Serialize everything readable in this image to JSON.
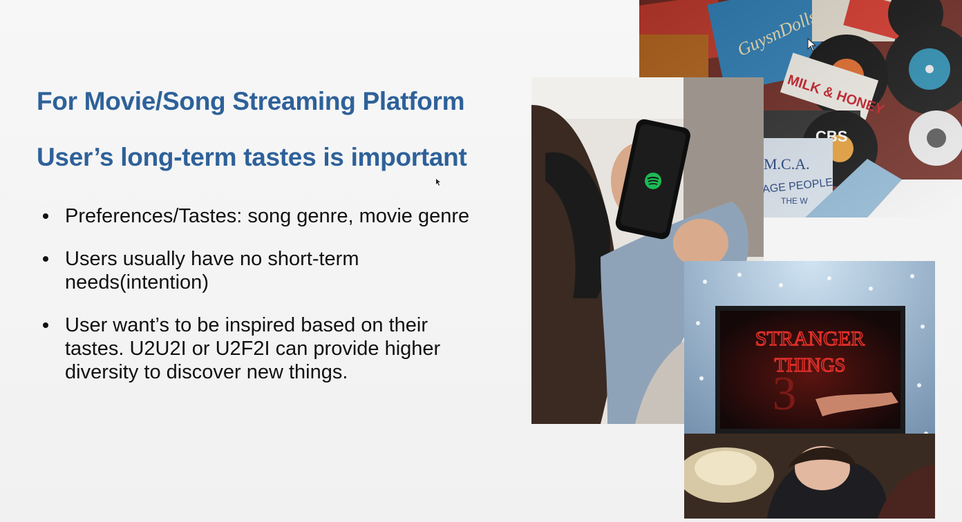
{
  "slide": {
    "title": "For Movie/Song Streaming Platform",
    "subtitle": "User’s long-term tastes is important",
    "bullets": [
      "Preferences/Tastes: song genre, movie genre",
      "Users usually have no short-term needs(intention)",
      "User want’s to be inspired based on their tastes. U2U2I or U2F2I can provide higher diversity to discover new things."
    ]
  },
  "images": {
    "records": {
      "labels": [
        "GuysnDolls",
        "MILK & HONEY",
        "CBS",
        "M.C.A.",
        "AGE PEOPLE",
        "THE W"
      ]
    },
    "phone": {
      "icon": "spotify-logo-icon"
    },
    "tv": {
      "title_line1": "STRANGER",
      "title_line2": "THINGS",
      "number": "3"
    }
  },
  "colors": {
    "heading": "#2e6199",
    "text": "#111111"
  }
}
